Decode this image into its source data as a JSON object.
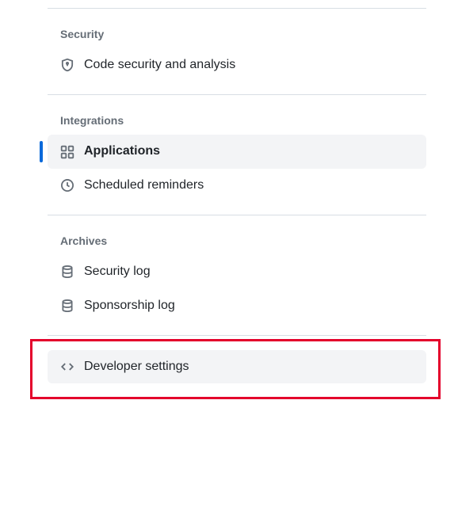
{
  "sections": {
    "security": {
      "heading": "Security",
      "items": [
        {
          "label": "Code security and analysis"
        }
      ]
    },
    "integrations": {
      "heading": "Integrations",
      "items": [
        {
          "label": "Applications"
        },
        {
          "label": "Scheduled reminders"
        }
      ]
    },
    "archives": {
      "heading": "Archives",
      "items": [
        {
          "label": "Security log"
        },
        {
          "label": "Sponsorship log"
        }
      ]
    }
  },
  "standalone": {
    "developer_settings": "Developer settings"
  }
}
